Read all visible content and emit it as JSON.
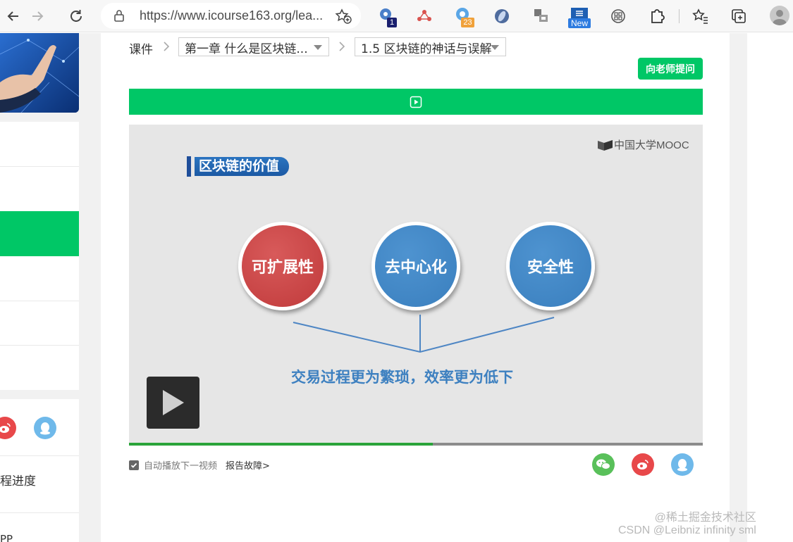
{
  "browser": {
    "url": "https://www.icourse163.org/lea...",
    "extensions": [
      {
        "icon": "puzzle-flower-icon",
        "badge": "1"
      },
      {
        "icon": "network-icon",
        "badge": ""
      },
      {
        "icon": "chat-bubble-icon",
        "badge": "23"
      },
      {
        "icon": "compass-icon",
        "badge": ""
      },
      {
        "icon": "screenshot-icon",
        "badge": ""
      },
      {
        "icon": "s-logo-icon",
        "badge": "New"
      },
      {
        "icon": "grid-circle-icon",
        "badge": ""
      }
    ]
  },
  "sidebar": {
    "progress_label": "程进度",
    "bottom_label": "PP"
  },
  "breadcrumb": {
    "root": "课件",
    "chapter": "第一章 什么是区块链...",
    "section": "1.5 区块链的神话与误解"
  },
  "ask_button": "向老师提问",
  "slide": {
    "logo": "中国大学MOOC",
    "title": "区块链的价值",
    "circles": [
      "可扩展性",
      "去中心化",
      "安全性"
    ],
    "caption": "交易过程更为繁琐，效率更为低下"
  },
  "video": {
    "progress": 0.53
  },
  "controls": {
    "autoplay_label": "自动播放下一视频",
    "autoplay_checked": true,
    "report_label": "报告故障>"
  },
  "share": [
    "wechat-icon",
    "weibo-icon",
    "qq-icon"
  ],
  "watermark": {
    "line1": "@稀土掘金技术社区",
    "line2": "CSDN @Leibniz infinity sml"
  },
  "colors": {
    "accent_green": "#00c766",
    "progress_green": "#2aa43a",
    "slide_red": "#c03a3b",
    "slide_blue": "#3a7fbe"
  }
}
